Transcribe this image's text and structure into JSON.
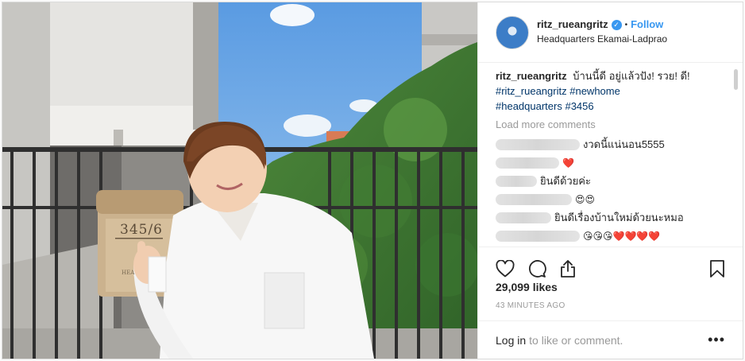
{
  "post": {
    "username": "ritz_rueangritz",
    "verified_mark": "✓",
    "dot": "•",
    "follow_label": "Follow",
    "location": "Headquarters Ekamai-Ladprao"
  },
  "photo": {
    "mailbox_number": "345/6",
    "mailbox_small_text": "HEA"
  },
  "caption": {
    "username": "ritz_rueangritz",
    "text": "บ้านนี้ดี อยู่แล้วปัง! รวย! ดี!",
    "hashtags": [
      "#ritz_rueangritz",
      "#newhome",
      "#headquarters",
      "#3456"
    ]
  },
  "load_more_label": "Load more comments",
  "comments": [
    {
      "text": "งวดนี้แน่นอน5555"
    },
    {
      "text": "❤️"
    },
    {
      "text": "ยินดีด้วยค่ะ"
    },
    {
      "text": "😍😍"
    },
    {
      "text": "ยินดีเรื่องบ้านใหม่ด้วยนะหมอ"
    },
    {
      "text": "😘😘😘❤️❤️❤️❤️"
    }
  ],
  "icons": {
    "like": "heart-icon",
    "comment": "comment-icon",
    "share": "share-icon",
    "save": "bookmark-icon",
    "more": "more-options-icon"
  },
  "likes_text": "29,099 likes",
  "timestamp": "43 MINUTES AGO",
  "footer": {
    "login_label": "Log in",
    "rest_text": "to like or comment.",
    "more_label": "•••"
  },
  "colors": {
    "link_blue": "#3897f0",
    "hashtag": "#003569",
    "muted": "#999999",
    "heart_red": "#ed4956"
  }
}
